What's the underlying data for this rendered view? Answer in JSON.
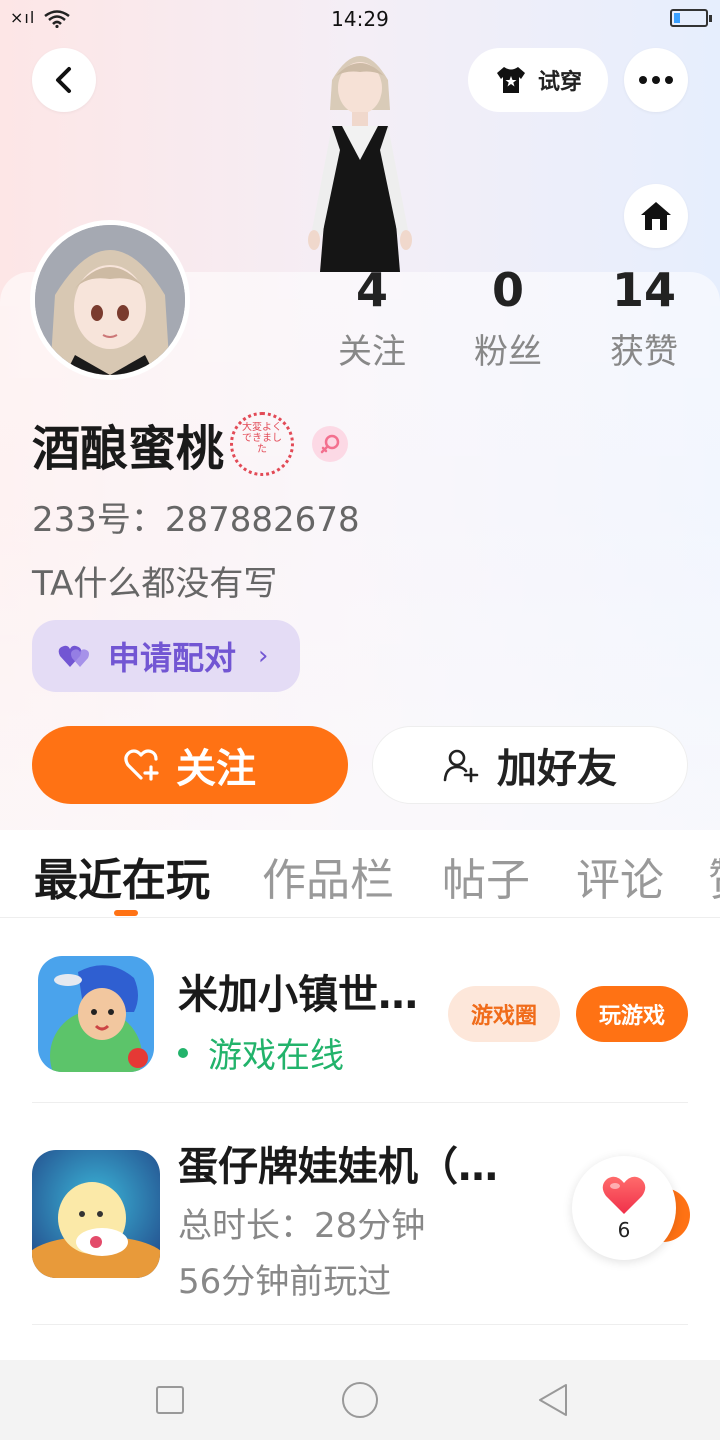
{
  "status_bar": {
    "time": "14:29",
    "signal": "×ıl"
  },
  "topbar": {
    "try_on_label": "试穿"
  },
  "stats": [
    {
      "value": "4",
      "label": "关注"
    },
    {
      "value": "0",
      "label": "粉丝"
    },
    {
      "value": "14",
      "label": "获赞"
    }
  ],
  "profile": {
    "name": "酒酿蜜桃",
    "stamp_text": "大変よくできました",
    "uid": "233号：287882678",
    "bio": "TA什么都没有写",
    "pair_label": "申请配对"
  },
  "actions": {
    "follow_label": "关注",
    "add_friend_label": "加好友"
  },
  "tabs": [
    {
      "label": "最近在玩"
    },
    {
      "label": "作品栏"
    },
    {
      "label": "帖子"
    },
    {
      "label": "评论"
    },
    {
      "label": "赞"
    }
  ],
  "games": [
    {
      "title": "米加小镇世…",
      "status": "游戏在线",
      "circle_label": "游戏圈",
      "play_label": "玩游戏"
    },
    {
      "title": "蛋仔牌娃娃机（…",
      "duration": "总时长：28分钟",
      "last_played": "56分钟前玩过"
    }
  ],
  "like_count": "6",
  "colors": {
    "accent": "#ff7214",
    "pair": "#7256d3",
    "online": "#22b36b"
  }
}
